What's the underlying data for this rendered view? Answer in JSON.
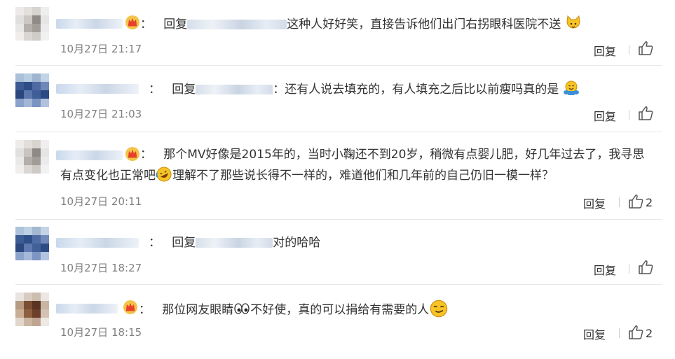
{
  "comments": [
    {
      "prefix": "：",
      "reply_word": "回复",
      "separator": "",
      "content": "这种人好好笑，直接告诉他们出门右拐眼科医院不送",
      "emoji": "cat-face-icon",
      "time": "10月27日 21:17",
      "reply": "回复",
      "likes": ""
    },
    {
      "prefix": "：",
      "reply_word": "回复",
      "separator": "：",
      "content": "还有人说去填充的，有人填充之后比以前瘦吗真的是",
      "emoji": "hugging-face-icon",
      "time": "10月27日 21:03",
      "reply": "回复",
      "likes": ""
    },
    {
      "prefix": "：",
      "line1": "那个MV好像是2015年的，当时小鞠还不到20岁，稍微有点婴儿肥，好几年过去了，我寻思",
      "line2a": "有点变化也正常吧",
      "line2b": "理解不了那些说长得不一样的，难道他们和几年前的自己仍旧一模一样？",
      "emoji": "rolling-laugh-icon",
      "time": "10月27日 20:11",
      "reply": "回复",
      "likes": "2"
    },
    {
      "prefix": "：",
      "reply_word": "回复",
      "content": "对的哈哈",
      "time": "10月27日 18:27",
      "reply": "回复",
      "likes": ""
    },
    {
      "prefix": "：",
      "part1": "那位网友眼睛",
      "part2": "不好使，真的可以捐给有需要的人",
      "emoji1": "eyes-icon",
      "emoji2": "smirk-face-icon",
      "time": "10月27日 18:15",
      "reply": "回复",
      "likes": "2"
    }
  ],
  "colors": {
    "text": "#333333",
    "time": "#808080",
    "separator": "#e8e8e8",
    "crown": "#e8402a",
    "emoji": "#f7c325"
  }
}
